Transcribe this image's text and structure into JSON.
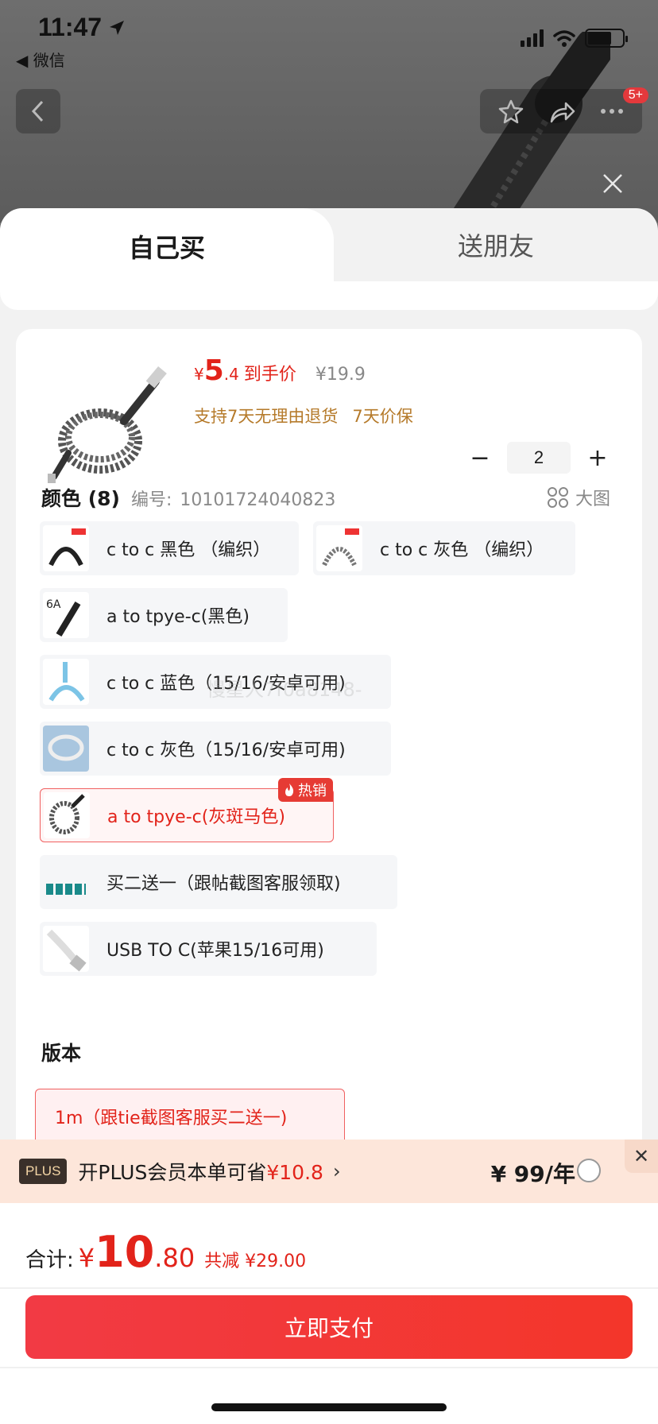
{
  "status_bar": {
    "time": "11:47",
    "back_app": "◀ 微信"
  },
  "nav": {
    "cart_badge": "5+"
  },
  "tabs": {
    "self": "自己买",
    "friend": "送朋友"
  },
  "product": {
    "price_yen": "¥",
    "price_int": "5",
    "price_dec": ".4",
    "price_tag": "到手价",
    "price_old": "¥19.9",
    "perk_return": "支持7天无理由退货",
    "perk_price_protect": "7天价保",
    "quantity": "2"
  },
  "color_section": {
    "title": "颜色 (8)",
    "code_label": "编号:",
    "code": "10101724040823",
    "big_image": "大图",
    "hot_label": "热销",
    "options": [
      {
        "label": "c to c 黑色 （编织）"
      },
      {
        "label": "c to c 灰色 （编织）"
      },
      {
        "label": "a to tpye-c(黑色)"
      },
      {
        "label": "c to c 蓝色（15/16/安卓可用)"
      },
      {
        "label": "c to c 灰色（15/16/安卓可用)"
      },
      {
        "label": "a to tpye-c(灰斑马色)"
      },
      {
        "label": "买二送一（跟帖截图客服领取)"
      },
      {
        "label": "USB  TO C(苹果15/16可用)"
      }
    ],
    "selected_index": 5
  },
  "version_section": {
    "title": "版本",
    "option": "1m（跟tie截图客服买二送一)"
  },
  "watermark": "慢星人7f0a8148-",
  "plus": {
    "logo": "PLUS",
    "text": "开PLUS会员本单可省",
    "save": "¥10.8",
    "price": "¥ 99/年"
  },
  "footer": {
    "total_label": "合计:",
    "total_yen": "¥",
    "total_int": "10",
    "total_dec": ".80",
    "total_save": "共减 ¥29.00",
    "pay_button": "立即支付"
  },
  "colors": {
    "accent": "#e2231a",
    "plus_bg": "#fde6da",
    "pay_button": "#f23a44"
  }
}
